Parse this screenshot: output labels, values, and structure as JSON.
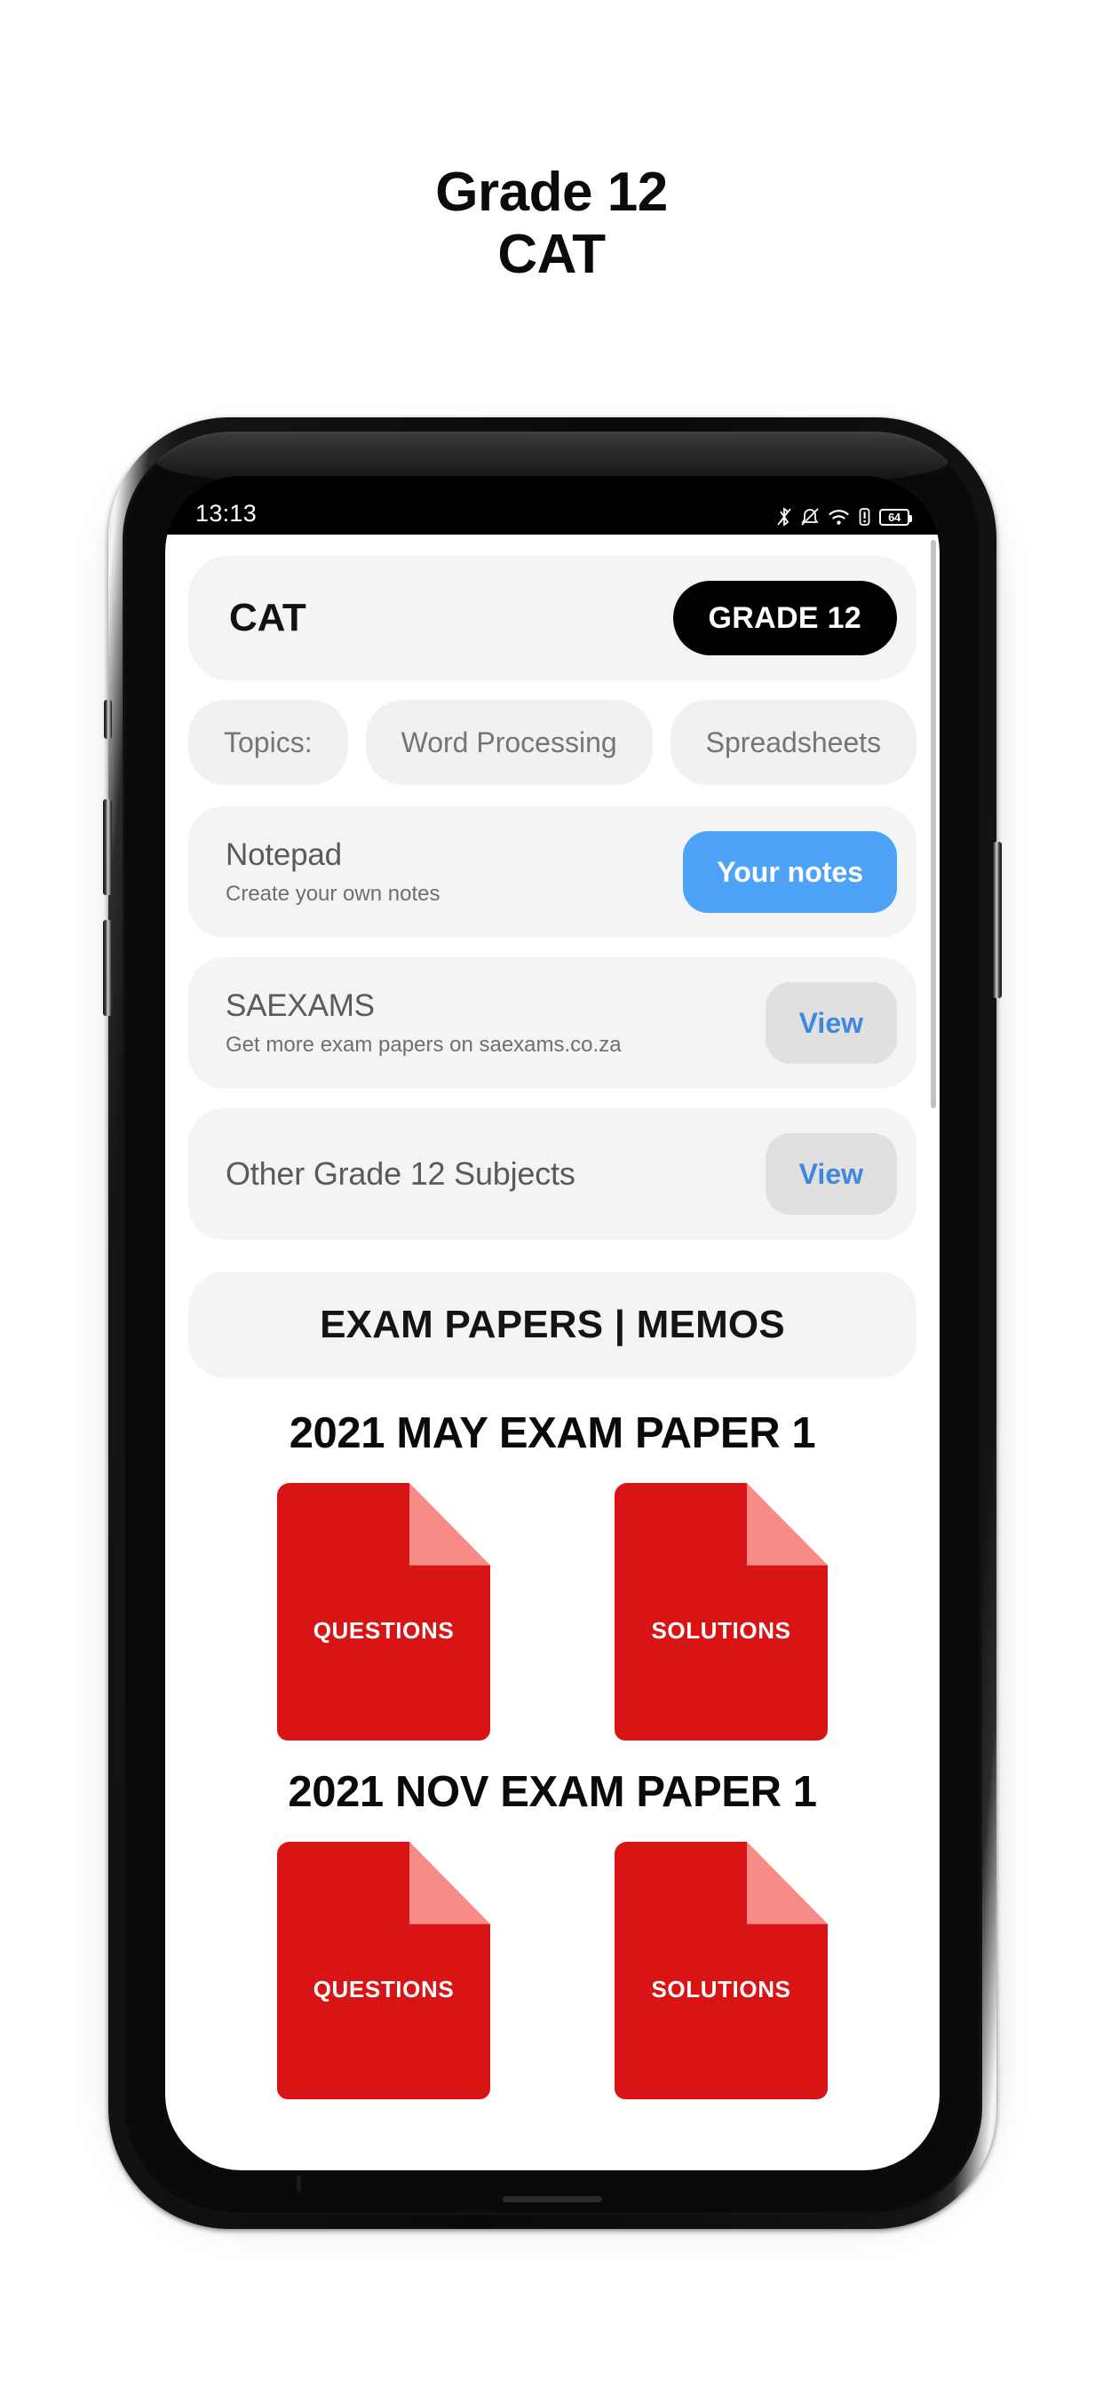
{
  "page": {
    "heading_line1": "Grade 12",
    "heading_line2": "CAT"
  },
  "status_bar": {
    "time": "13:13",
    "battery_level": "64",
    "icons": [
      "bluetooth-icon",
      "mute-icon",
      "wifi-icon",
      "alert-icon",
      "battery-icon"
    ]
  },
  "header": {
    "subject": "CAT",
    "grade_badge": "GRADE 12"
  },
  "topics": {
    "label": "Topics:",
    "chips": [
      "Word Processing",
      "Spreadsheets"
    ]
  },
  "cards": [
    {
      "title": "Notepad",
      "subtitle": "Create your own notes",
      "action": "Your notes",
      "style": "primary"
    },
    {
      "title": "SAEXAMS",
      "subtitle": "Get more exam papers on saexams.co.za",
      "action": "View",
      "style": "secondary"
    },
    {
      "title": "Other Grade 12 Subjects",
      "subtitle": "",
      "action": "View",
      "style": "secondary"
    }
  ],
  "section_banner": "EXAM PAPERS | MEMOS",
  "papers": [
    {
      "title": "2021 MAY EXAM PAPER 1",
      "questions_label": "QUESTIONS",
      "solutions_label": "SOLUTIONS"
    },
    {
      "title": "2021 NOV EXAM PAPER 1",
      "questions_label": "QUESTIONS",
      "solutions_label": "SOLUTIONS"
    }
  ],
  "colors": {
    "accent_blue": "#4da3f7",
    "link_blue": "#3f88e0",
    "pdf_red": "#d91414",
    "pdf_fold": "#f98b86",
    "card_gray": "#f4f4f4",
    "badge_black": "#000000"
  }
}
